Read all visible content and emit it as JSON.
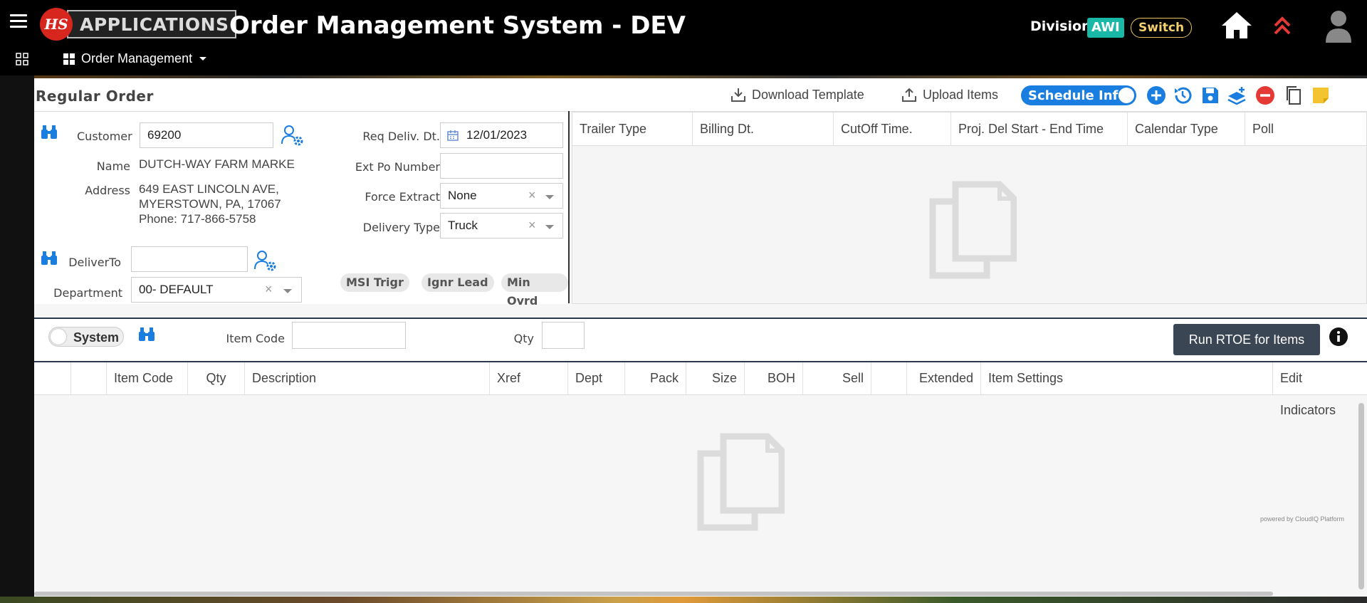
{
  "header": {
    "logo_mark": "HS",
    "logo_text": "APPLICATIONS",
    "app_title": "Order Management System - DEV",
    "division_label": "Division",
    "division_value": "AWI",
    "switch_label": "Switch",
    "module_menu": "Order Management"
  },
  "toolbar": {
    "page_title": "Regular Order",
    "download_template": "Download Template",
    "upload_items": "Upload Items",
    "schedule_info": "Schedule Info"
  },
  "form": {
    "customer_label": "Customer",
    "customer_value": "69200",
    "name_label": "Name",
    "name_value": "DUTCH-WAY FARM MARKE",
    "address_label": "Address",
    "address_line1": "649 EAST LINCOLN AVE,",
    "address_line2": "MYERSTOWN, PA, 17067",
    "address_phone": "Phone: 717-866-5758",
    "deliverto_label": "DeliverTo",
    "deliverto_value": "",
    "department_label": "Department",
    "department_value": "00- DEFAULT",
    "req_deliv_label": "Req Deliv. Dt.",
    "req_deliv_value": "12/01/2023",
    "ext_po_label": "Ext Po Number",
    "ext_po_value": "",
    "force_extract_label": "Force Extract",
    "force_extract_value": "None",
    "delivery_type_label": "Delivery Type",
    "delivery_type_value": "Truck",
    "pills": [
      "MSI Trigr",
      "Ignr Lead",
      "Min Ovrd"
    ]
  },
  "schedule_grid": {
    "columns": [
      "Trailer Type",
      "Billing Dt.",
      "CutOff Time.",
      "Proj. Del Start - End Time",
      "Calendar Type",
      "Poll"
    ]
  },
  "entry": {
    "system_toggle": "System",
    "item_code_label": "Item Code",
    "item_code_value": "",
    "qty_label": "Qty",
    "qty_value": "",
    "run_button": "Run RTOE for Items"
  },
  "item_grid": {
    "columns": [
      "Item Code",
      "Qty",
      "Description",
      "Xref",
      "Dept",
      "Pack",
      "Size",
      "BOH",
      "Sell",
      "Extended",
      "Item Settings",
      "Edit Indicators"
    ]
  },
  "footer": {
    "powered_by": "powered by CloudIQ Platform"
  },
  "colors": {
    "header_bg": "#000000",
    "division_badge": "#1ab9a7",
    "switch_color": "#f4d06f",
    "primary_blue": "#1a7de0",
    "danger_red": "#e53935",
    "run_button_bg": "#3b4654"
  }
}
